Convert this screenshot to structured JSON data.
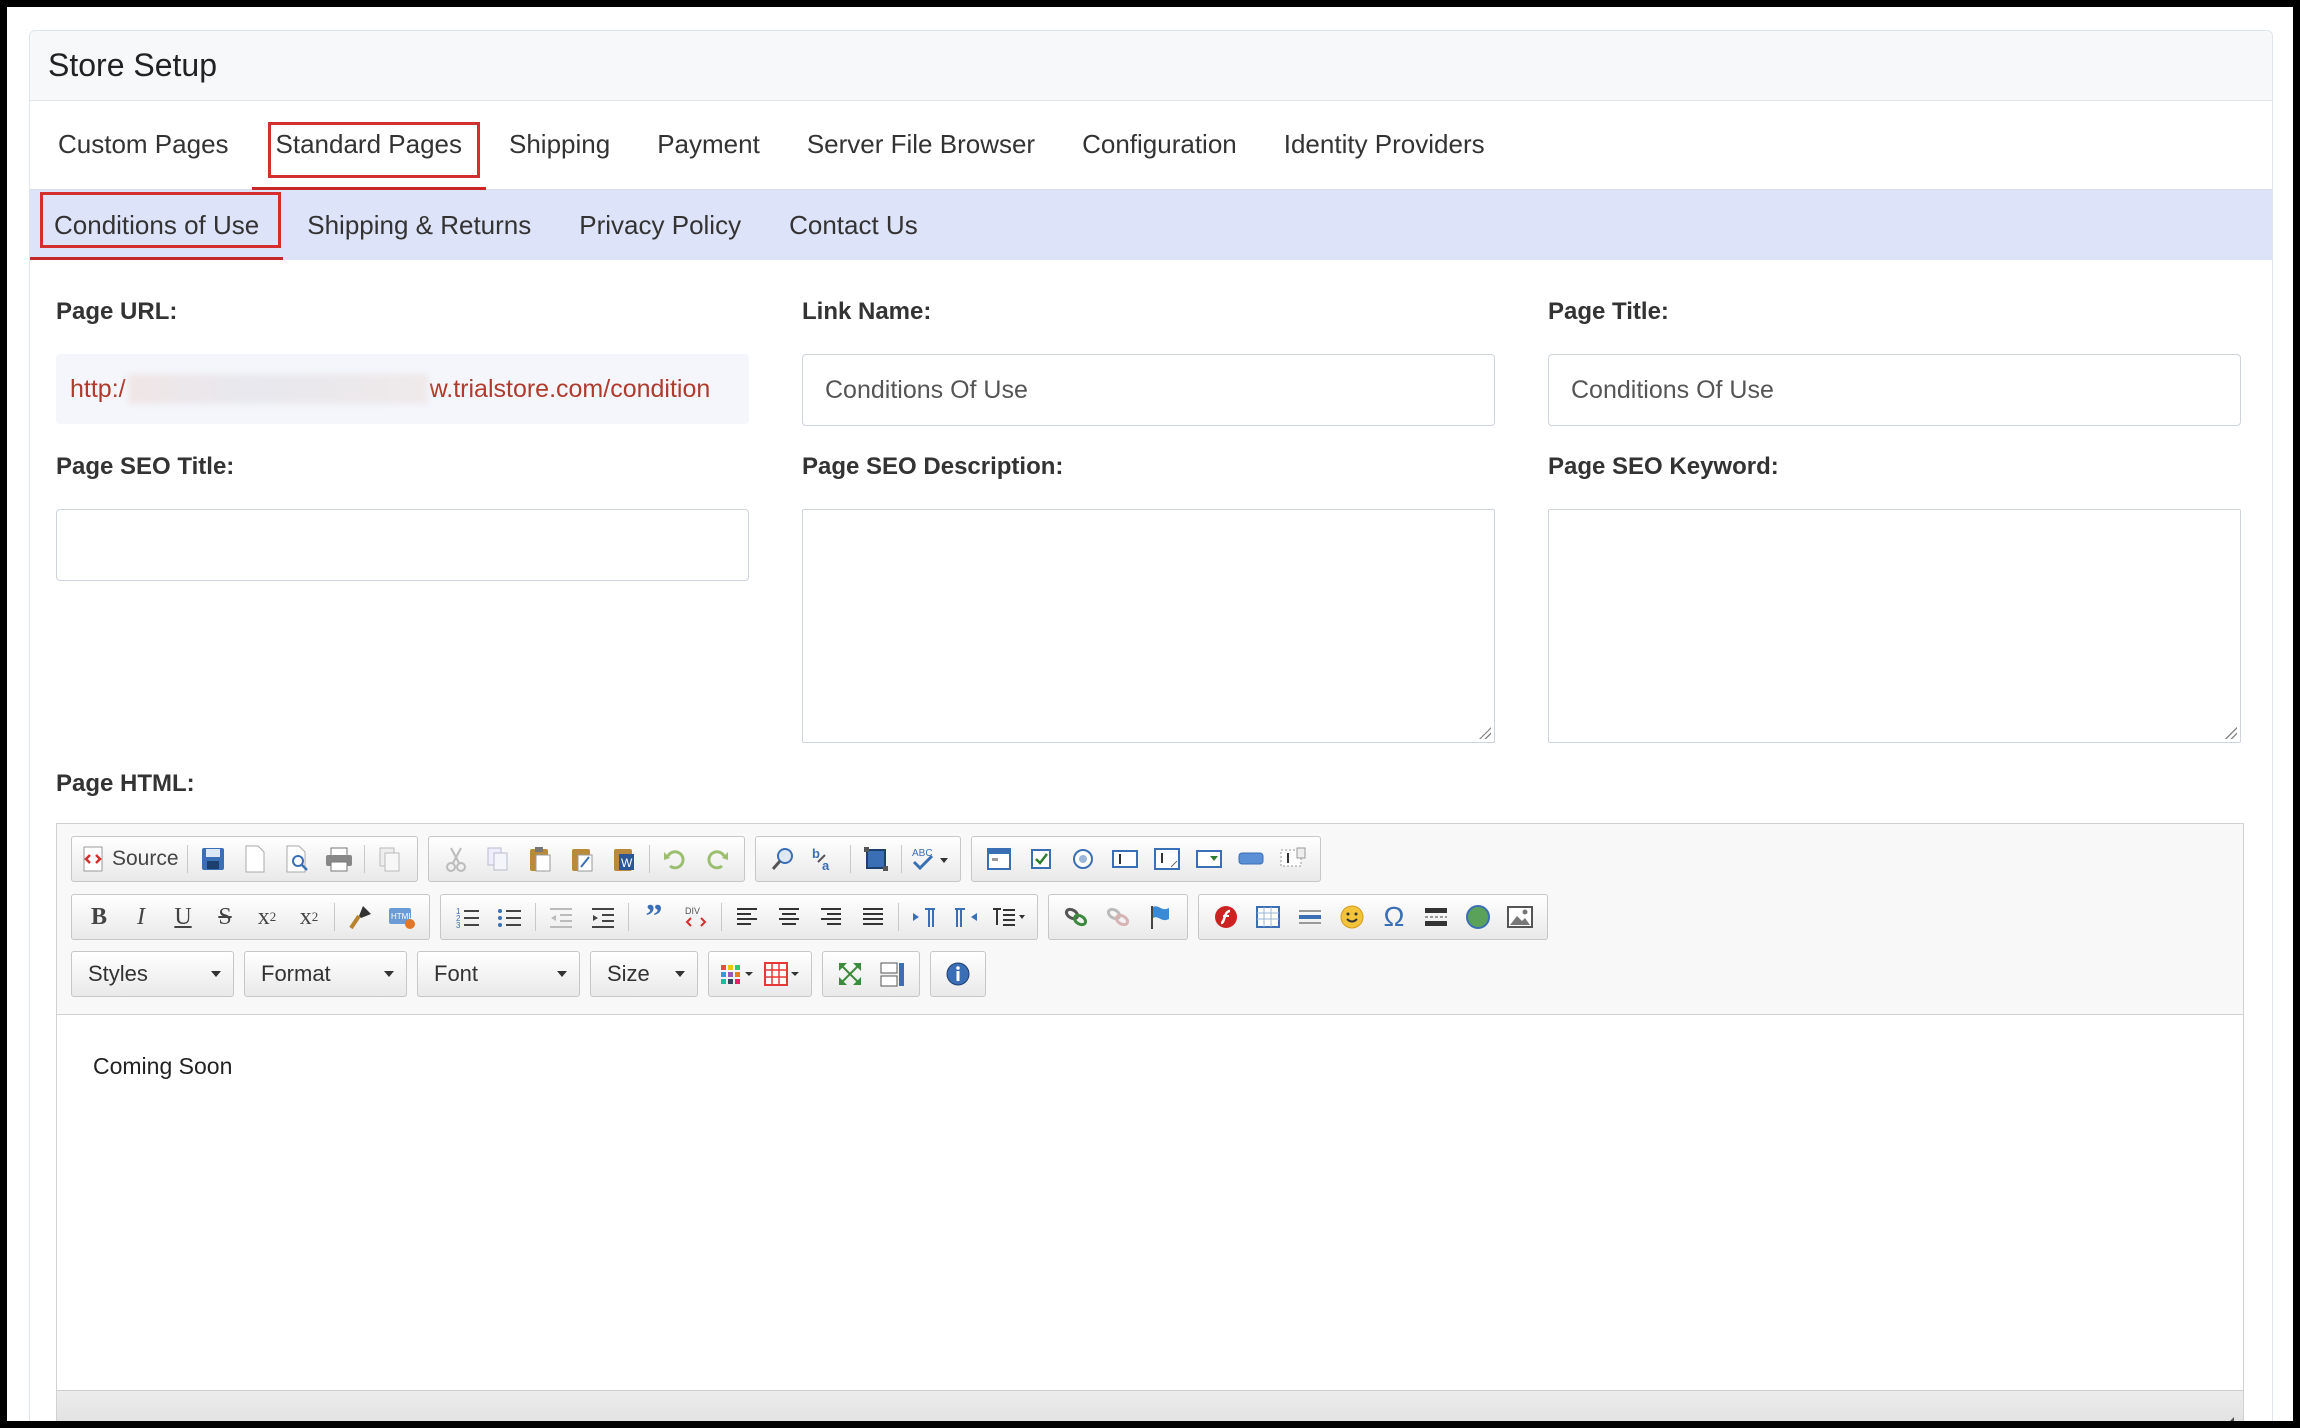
{
  "panel": {
    "title": "Store Setup"
  },
  "main_tabs": [
    {
      "label": "Custom Pages"
    },
    {
      "label": "Standard Pages"
    },
    {
      "label": "Shipping"
    },
    {
      "label": "Payment"
    },
    {
      "label": "Server File Browser"
    },
    {
      "label": "Configuration"
    },
    {
      "label": "Identity Providers"
    }
  ],
  "sub_tabs": [
    {
      "label": "Conditions of Use"
    },
    {
      "label": "Shipping & Returns"
    },
    {
      "label": "Privacy Policy"
    },
    {
      "label": "Contact Us"
    }
  ],
  "form": {
    "page_url_label": "Page URL:",
    "page_url_prefix": "http:/",
    "page_url_suffix": "w.trialstore.com/condition",
    "link_name_label": "Link Name:",
    "link_name_value": "Conditions Of Use",
    "page_title_label": "Page Title:",
    "page_title_value": "Conditions Of Use",
    "seo_title_label": "Page SEO Title:",
    "seo_title_value": "",
    "seo_desc_label": "Page SEO Description:",
    "seo_keyword_label": "Page SEO Keyword:",
    "page_html_label": "Page HTML:"
  },
  "editor": {
    "source_label": "Source",
    "styles_label": "Styles",
    "format_label": "Format",
    "font_label": "Font",
    "size_label": "Size",
    "content": "Coming Soon"
  },
  "colors": {
    "accent_red": "#d32f2f",
    "subtab_bg": "#dde3f9",
    "url_text": "#b03a2e"
  }
}
